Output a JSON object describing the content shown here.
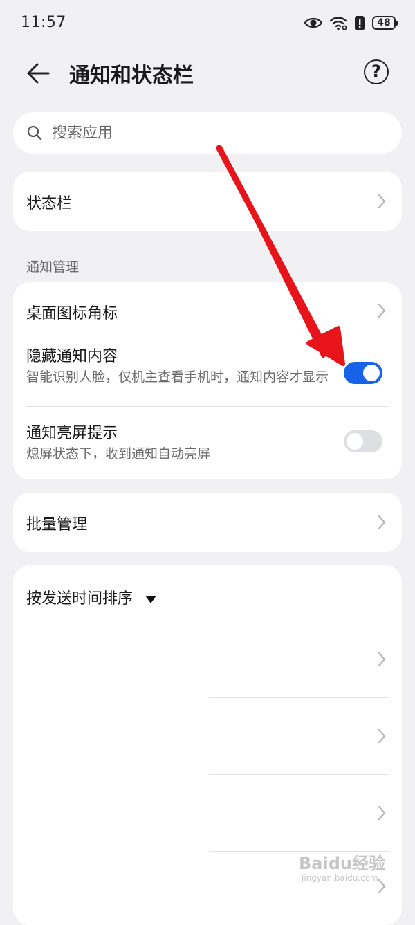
{
  "status_bar": {
    "time": "11:57",
    "battery": "48",
    "icons": [
      "eye-icon",
      "wifi-icon",
      "alert-icon",
      "battery-icon"
    ]
  },
  "header": {
    "title": "通知和状态栏",
    "back_icon": "back-arrow-icon",
    "help_label": "?"
  },
  "search": {
    "placeholder": "搜索应用",
    "icon": "search-icon"
  },
  "status_bar_row": {
    "label": "状态栏"
  },
  "notification_section": {
    "label": "通知管理",
    "items": [
      {
        "title": "桌面图标角标"
      },
      {
        "title": "隐藏通知内容",
        "subtitle": "智能识别人脸，仅机主查看手机时，通知内容才显示",
        "toggle": true
      },
      {
        "title": "通知亮屏提示",
        "subtitle": "熄屏状态下，收到通知自动亮屏",
        "toggle": false
      }
    ]
  },
  "batch_row": {
    "label": "批量管理"
  },
  "sort": {
    "label": "按发送时间排序"
  },
  "watermark": {
    "brand": "Baidu经验",
    "url": "jingyan.baidu.com"
  },
  "colors": {
    "accent": "#1662e8",
    "annotation_arrow": "#e8141b",
    "background": "#f1f1f3"
  }
}
